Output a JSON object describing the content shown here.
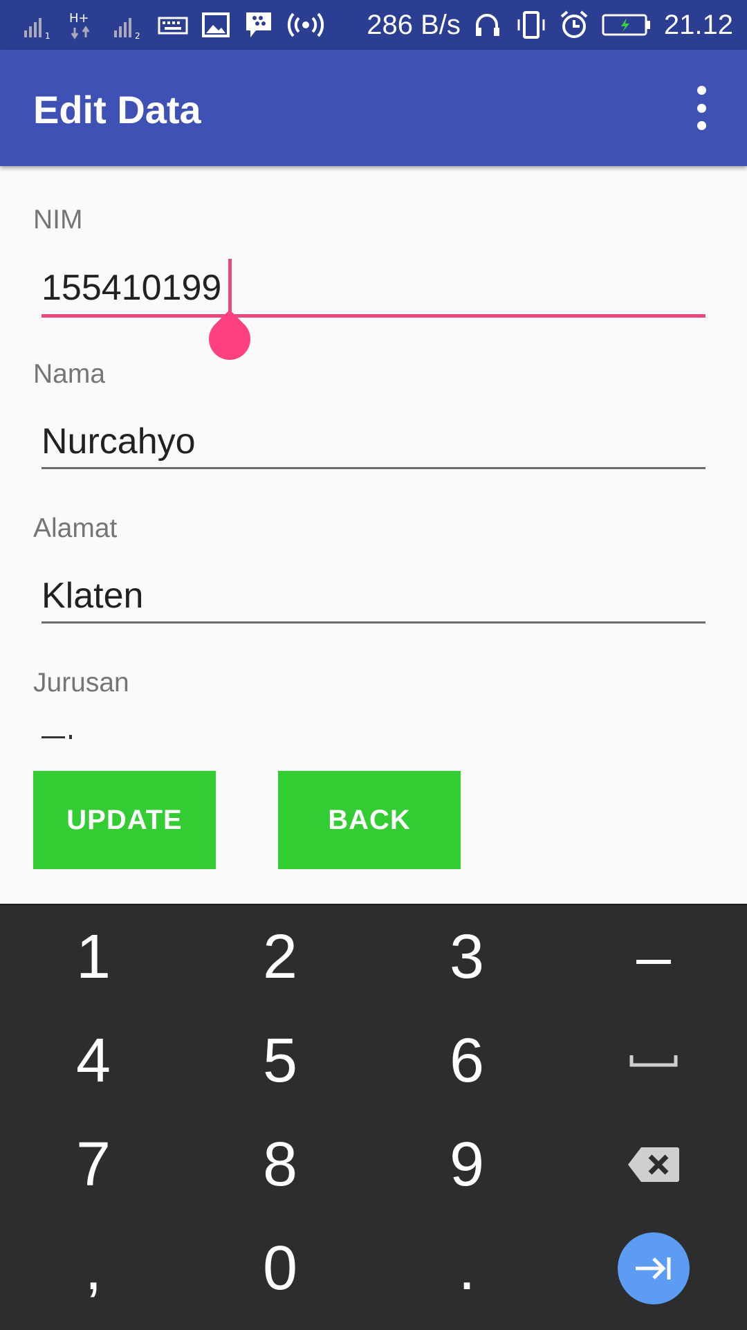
{
  "status_bar": {
    "speed": "286 B/s",
    "time": "21.12",
    "icons": [
      "signal-sim1-icon",
      "signal-h-plus-icon",
      "signal-sim2-icon",
      "keyboard-icon",
      "image-icon",
      "bbm-icon",
      "hotspot-icon",
      "headset-icon",
      "vibrate-icon",
      "alarm-icon",
      "battery-charging-icon"
    ]
  },
  "app_bar": {
    "title": "Edit Data",
    "menu_icon": "more-vert-icon"
  },
  "form": {
    "nim_label": "NIM",
    "nim_value": "155410199",
    "nama_label": "Nama",
    "nama_value": "Nurcahyo",
    "alamat_label": "Alamat",
    "alamat_value": "Klaten",
    "jurusan_label": "Jurusan"
  },
  "buttons": {
    "update": "UPDATE",
    "back": "BACK"
  },
  "keyboard": {
    "row1": [
      "1",
      "2",
      "3",
      "–"
    ],
    "row2": [
      "4",
      "5",
      "6"
    ],
    "row3": [
      "7",
      "8",
      "9"
    ],
    "row4": [
      ",",
      "0",
      "."
    ],
    "space_icon": "space-icon",
    "backspace_icon": "backspace-icon",
    "next_icon": "next-field-icon"
  },
  "colors": {
    "status_bar": "#2c3e92",
    "app_bar": "#3f51b5",
    "accent": "#e8487c",
    "button": "#33cc33",
    "keyboard_bg": "#2d2d2d",
    "next_key": "#5c9cf2"
  }
}
